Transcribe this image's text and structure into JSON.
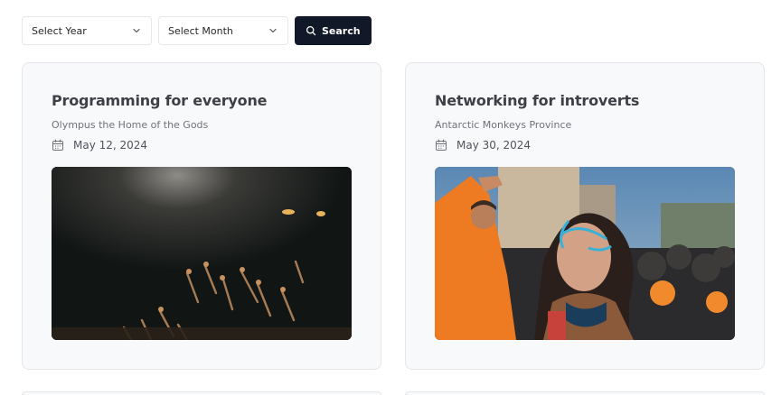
{
  "filters": {
    "year_placeholder": "Select Year",
    "month_placeholder": "Select Month",
    "search_label": "Search"
  },
  "events": [
    {
      "title": "Programming for everyone",
      "location": "Olympus the Home of the Gods",
      "date": "May 12, 2024",
      "image_icon": "concert-crowd-image"
    },
    {
      "title": "Networking for introverts",
      "location": "Antarctic Monkeys Province",
      "date": "May 30, 2024",
      "image_icon": "festival-crowd-image"
    }
  ],
  "colors": {
    "button_bg": "#111827",
    "card_bg": "#f8f9fb",
    "border": "#e5e7eb"
  }
}
